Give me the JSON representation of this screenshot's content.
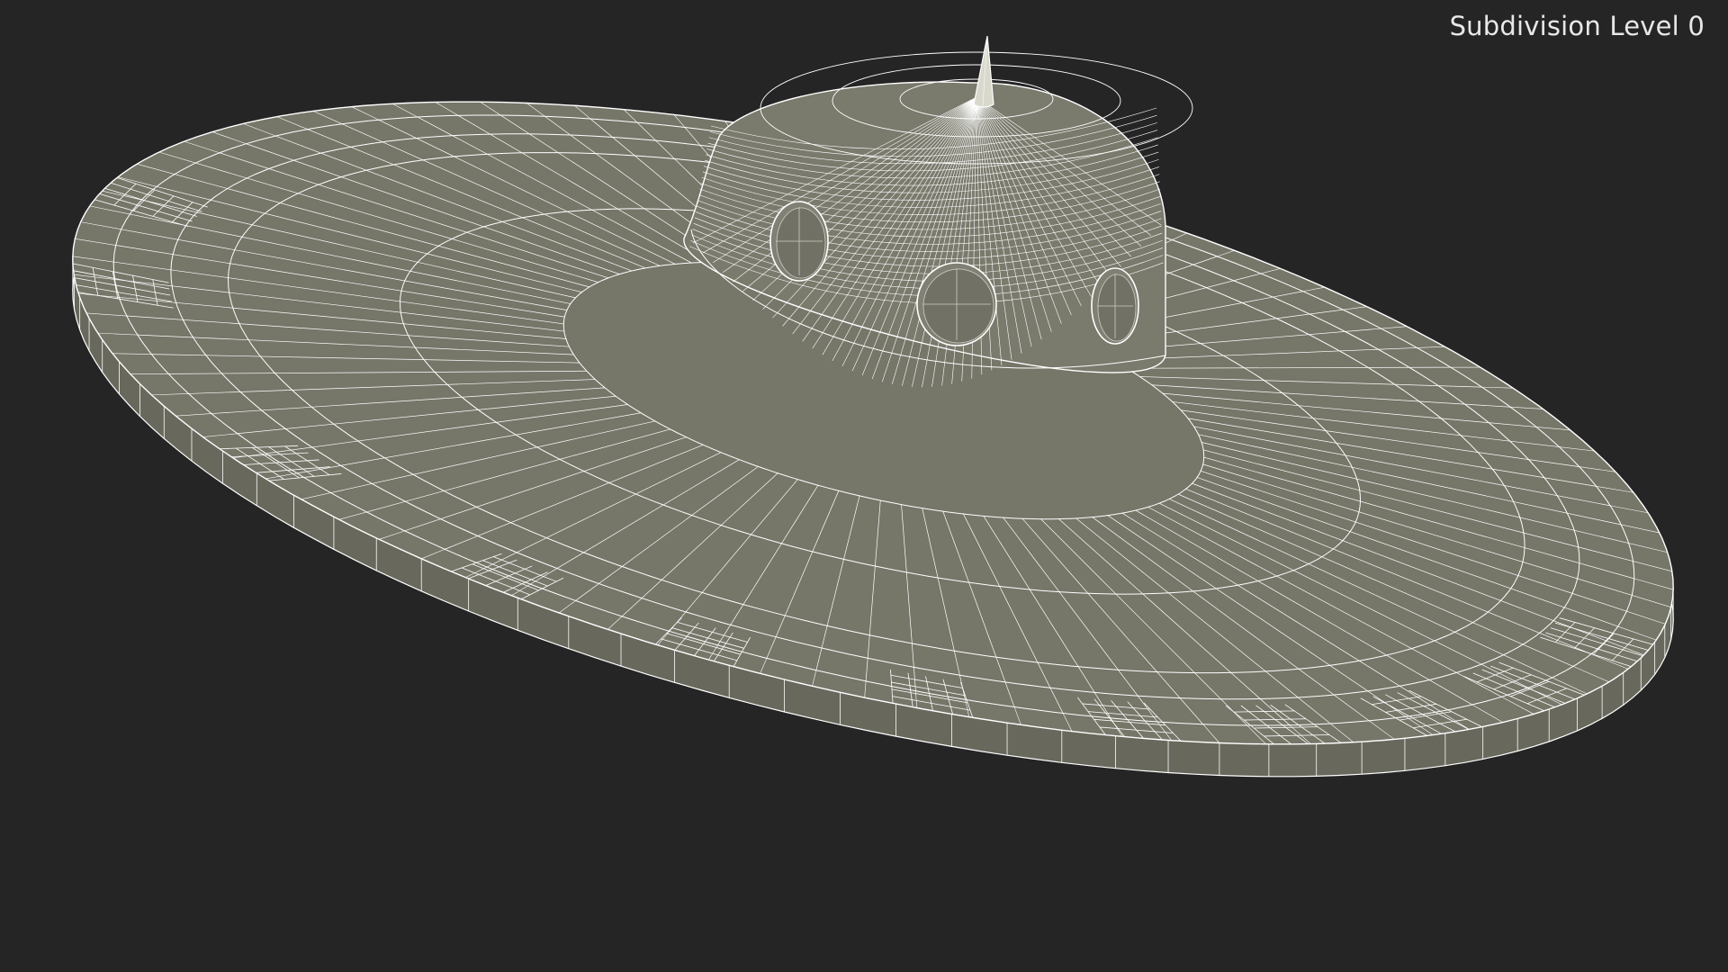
{
  "viewport": {
    "label": "Subdivision Level 0",
    "background": "#252525",
    "mesh_fill": "#767669",
    "wire_color": "#ffffff"
  },
  "model": {
    "name": "flying-saucer",
    "display": "wireframe-on-shaded"
  }
}
